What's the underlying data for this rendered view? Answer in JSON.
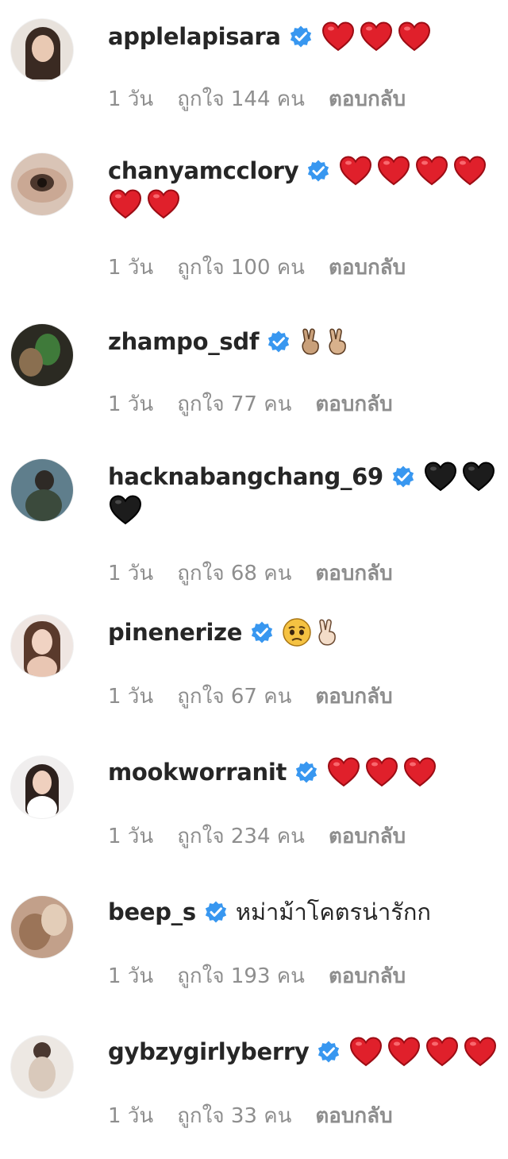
{
  "comments": [
    {
      "username": "applelapisara",
      "text": "",
      "emojis_line1": [
        "red-heart",
        "red-heart",
        "red-heart"
      ],
      "emojis_line2": [],
      "time": "1 วัน",
      "likes": "ถูกใจ 144 คน",
      "reply": "ตอบกลับ"
    },
    {
      "username": "chanyamcclory",
      "text": "",
      "emojis_line1": [
        "red-heart",
        "red-heart",
        "red-heart",
        "red-heart"
      ],
      "emojis_line2": [
        "red-heart",
        "red-heart"
      ],
      "time": "1 วัน",
      "likes": "ถูกใจ 100 คน",
      "reply": "ตอบกลับ"
    },
    {
      "username": "zhampo_sdf",
      "text": "",
      "emojis_line1": [
        "victory-hand",
        "victory-hand"
      ],
      "emojis_line2": [],
      "time": "1 วัน",
      "likes": "ถูกใจ 77 คน",
      "reply": "ตอบกลับ"
    },
    {
      "username": "hacknabangchang_69",
      "text": "",
      "emojis_line1": [
        "black-heart",
        "black-heart"
      ],
      "emojis_line2": [
        "black-heart"
      ],
      "time": "1 วัน",
      "likes": "ถูกใจ 68 คน",
      "reply": "ตอบกลับ"
    },
    {
      "username": "pinenerize",
      "text": "",
      "emojis_line1": [
        "pleading-face",
        "victory-hand"
      ],
      "emojis_line2": [],
      "time": "1 วัน",
      "likes": "ถูกใจ 67 คน",
      "reply": "ตอบกลับ"
    },
    {
      "username": "mookworranit",
      "text": "",
      "emojis_line1": [
        "red-heart",
        "red-heart",
        "red-heart"
      ],
      "emojis_line2": [],
      "time": "1 วัน",
      "likes": "ถูกใจ 234 คน",
      "reply": "ตอบกลับ"
    },
    {
      "username": "beep_s",
      "text": "หม่าม้าโคตรน่ารักก",
      "emojis_line1": [],
      "emojis_line2": [],
      "time": "1 วัน",
      "likes": "ถูกใจ 193 คน",
      "reply": "ตอบกลับ"
    },
    {
      "username": "gybzygirlyberry",
      "text": "",
      "emojis_line1": [
        "red-heart",
        "red-heart",
        "red-heart",
        "red-heart"
      ],
      "emojis_line2": [],
      "time": "1 วัน",
      "likes": "ถูกใจ 33 คน",
      "reply": "ตอบกลับ"
    }
  ],
  "colors": {
    "username": "#262626",
    "meta": "#8e8e8e",
    "verified": "#3897f0",
    "red_heart": "#e0202b",
    "black_heart": "#1c1c1c"
  },
  "icons": {
    "verified": "verified-badge-icon"
  }
}
